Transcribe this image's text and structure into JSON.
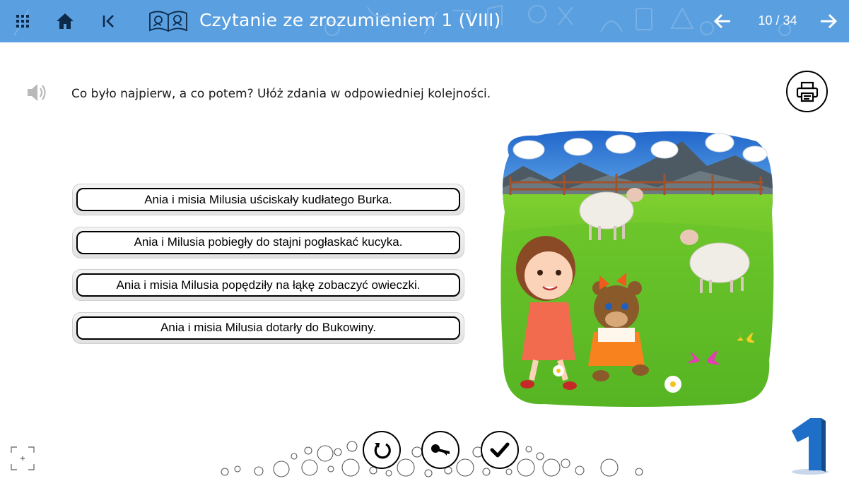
{
  "header": {
    "title": "Czytanie ze zrozumieniem 1 (VIII)",
    "page": "10 / 34",
    "accent_color": "#5a9fe0",
    "icons": [
      "grid-menu-icon",
      "home-icon",
      "first-page-icon",
      "open-book-icon",
      "arrow-left-icon",
      "arrow-right-icon"
    ]
  },
  "task": {
    "instruction": "Co było najpierw, a co potem? Ułóż zdania w odpowiedniej kolejności."
  },
  "sentences": [
    "Ania i misia Milusia uściskały kudłatego Burka.",
    "Ania i Milusia pobiegły do stajni pogłaskać kucyka.",
    "Ania i misia Milusia popędziły na łąkę zobaczyć owieczki.",
    "Ania i misia Milusia dotarły do Bukowiny."
  ],
  "controls": {
    "icons": [
      "reset-icon",
      "key-icon",
      "check-icon",
      "print-icon",
      "speaker-icon",
      "fullscreen-icon"
    ]
  },
  "brand": {
    "logo_digit": "1"
  }
}
